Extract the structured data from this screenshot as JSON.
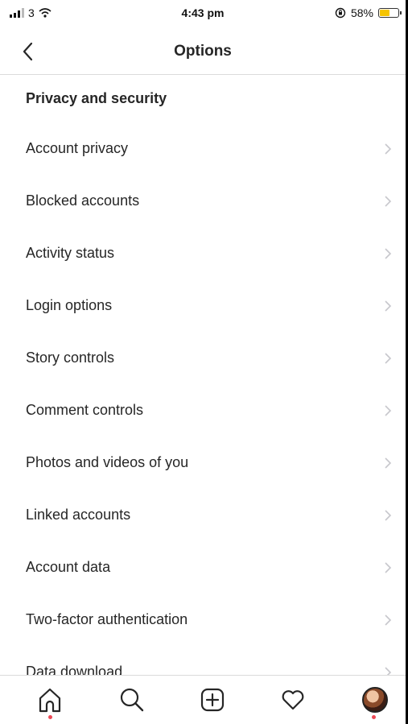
{
  "status_bar": {
    "carrier": "3",
    "time": "4:43 pm",
    "battery_percent": "58%",
    "battery_level": 0.58,
    "battery_color": "#f5c400"
  },
  "nav": {
    "title": "Options",
    "back_icon": "chevron-left-icon"
  },
  "section": {
    "header": "Privacy and security"
  },
  "items": [
    {
      "label": "Account privacy"
    },
    {
      "label": "Blocked accounts"
    },
    {
      "label": "Activity status"
    },
    {
      "label": "Login options"
    },
    {
      "label": "Story controls"
    },
    {
      "label": "Comment controls"
    },
    {
      "label": "Photos and videos of you"
    },
    {
      "label": "Linked accounts"
    },
    {
      "label": "Account data"
    },
    {
      "label": "Two-factor authentication"
    },
    {
      "label": "Data download"
    }
  ],
  "tab_bar": {
    "tabs": [
      "home-icon",
      "search-icon",
      "add-post-icon",
      "heart-icon",
      "profile-avatar"
    ],
    "notification_color": "#ed4956"
  }
}
